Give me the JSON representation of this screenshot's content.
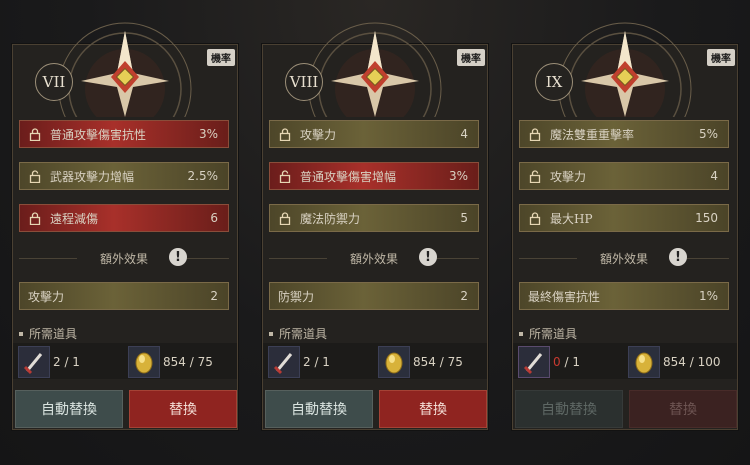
{
  "panels": [
    {
      "roman": "VII",
      "badge": "機率",
      "stats": [
        {
          "label": "普通攻擊傷害抗性",
          "value": "3%",
          "locked": true,
          "style": "red"
        },
        {
          "label": "武器攻擊力增幅",
          "value": "2.5%",
          "locked": false,
          "style": "gold"
        },
        {
          "label": "遠程減傷",
          "value": "6",
          "locked": true,
          "style": "red"
        }
      ],
      "extra_title": "額外效果",
      "extra_stat": {
        "label": "攻擊力",
        "value": "2"
      },
      "req_title": "所需道具",
      "item1_count": "2 / 1",
      "item1_low": false,
      "item2_count": "854 / 75",
      "auto_label": "自動替換",
      "replace_label": "替換",
      "disabled": false
    },
    {
      "roman": "VIII",
      "badge": "機率",
      "stats": [
        {
          "label": "攻擊力",
          "value": "4",
          "locked": true,
          "style": "gold"
        },
        {
          "label": "普通攻擊傷害增幅",
          "value": "3%",
          "locked": false,
          "style": "red"
        },
        {
          "label": "魔法防禦力",
          "value": "5",
          "locked": true,
          "style": "gold"
        }
      ],
      "extra_title": "額外效果",
      "extra_stat": {
        "label": "防禦力",
        "value": "2"
      },
      "req_title": "所需道具",
      "item1_count": "2 / 1",
      "item1_low": false,
      "item2_count": "854 / 75",
      "auto_label": "自動替換",
      "replace_label": "替換",
      "disabled": false
    },
    {
      "roman": "IX",
      "badge": "機率",
      "stats": [
        {
          "label": "魔法雙重重擊率",
          "value": "5%",
          "locked": true,
          "style": "gold"
        },
        {
          "label": "攻擊力",
          "value": "4",
          "locked": false,
          "style": "gold"
        },
        {
          "label": "最大HP",
          "value": "150",
          "locked": true,
          "style": "gold"
        }
      ],
      "extra_title": "額外效果",
      "extra_stat": {
        "label": "最終傷害抗性",
        "value": "1%"
      },
      "req_title": "所需道具",
      "item1_count_low": "0",
      "item1_count_rest": " / 1",
      "item1_low": true,
      "item2_count": "854 / 100",
      "auto_label": "自動替換",
      "replace_label": "替換",
      "disabled": true
    }
  ],
  "icons": {
    "lock": "lock-icon",
    "unlock": "unlock-icon",
    "info": "exclamation-icon",
    "weapon_item": "sword-item-icon",
    "gold_item": "gold-egg-item-icon",
    "emblem": "compass-star-emblem"
  },
  "colors": {
    "gold_row": "#6b6238",
    "red_row": "#a8302a",
    "auto_button": "#3e4c4b",
    "replace_button": "#8f2420",
    "low_count": "#c83a30"
  }
}
